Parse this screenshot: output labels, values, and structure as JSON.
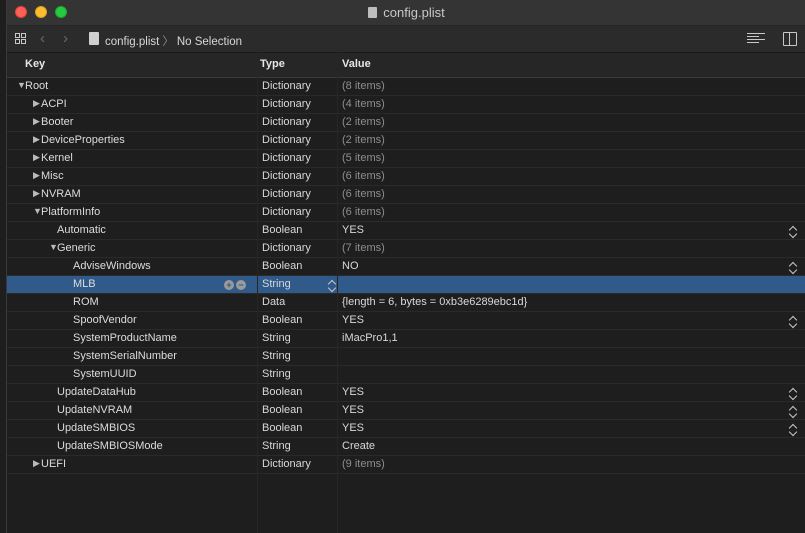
{
  "window": {
    "title": "config.plist"
  },
  "toolbar": {
    "file": "config.plist",
    "separator": "〉",
    "selection": "No Selection"
  },
  "columns": {
    "key": "Key",
    "type": "Type",
    "value": "Value"
  },
  "rows": [
    {
      "key": "Root",
      "type": "Dictionary",
      "value": "(8 items)",
      "muted": true,
      "indent": 0,
      "disclosure": "open"
    },
    {
      "key": "ACPI",
      "type": "Dictionary",
      "value": "(4 items)",
      "muted": true,
      "indent": 1,
      "disclosure": "closed"
    },
    {
      "key": "Booter",
      "type": "Dictionary",
      "value": "(2 items)",
      "muted": true,
      "indent": 1,
      "disclosure": "closed"
    },
    {
      "key": "DeviceProperties",
      "type": "Dictionary",
      "value": "(2 items)",
      "muted": true,
      "indent": 1,
      "disclosure": "closed"
    },
    {
      "key": "Kernel",
      "type": "Dictionary",
      "value": "(5 items)",
      "muted": true,
      "indent": 1,
      "disclosure": "closed"
    },
    {
      "key": "Misc",
      "type": "Dictionary",
      "value": "(6 items)",
      "muted": true,
      "indent": 1,
      "disclosure": "closed"
    },
    {
      "key": "NVRAM",
      "type": "Dictionary",
      "value": "(6 items)",
      "muted": true,
      "indent": 1,
      "disclosure": "closed"
    },
    {
      "key": "PlatformInfo",
      "type": "Dictionary",
      "value": "(6 items)",
      "muted": true,
      "indent": 1,
      "disclosure": "open"
    },
    {
      "key": "Automatic",
      "type": "Boolean",
      "value": "YES",
      "indent": 2,
      "stepper": true
    },
    {
      "key": "Generic",
      "type": "Dictionary",
      "value": "(7 items)",
      "muted": true,
      "indent": 2,
      "disclosure": "open"
    },
    {
      "key": "AdviseWindows",
      "type": "Boolean",
      "value": "NO",
      "indent": 3,
      "stepper": true
    },
    {
      "key": "MLB",
      "type": "String",
      "value": "",
      "indent": 3,
      "selected": true
    },
    {
      "key": "ROM",
      "type": "Data",
      "value": "{length = 6, bytes = 0xb3e6289ebc1d}",
      "indent": 3
    },
    {
      "key": "SpoofVendor",
      "type": "Boolean",
      "value": "YES",
      "indent": 3,
      "stepper": true
    },
    {
      "key": "SystemProductName",
      "type": "String",
      "value": "iMacPro1,1",
      "indent": 3
    },
    {
      "key": "SystemSerialNumber",
      "type": "String",
      "value": "",
      "indent": 3
    },
    {
      "key": "SystemUUID",
      "type": "String",
      "value": "",
      "indent": 3
    },
    {
      "key": "UpdateDataHub",
      "type": "Boolean",
      "value": "YES",
      "indent": 2,
      "stepper": true
    },
    {
      "key": "UpdateNVRAM",
      "type": "Boolean",
      "value": "YES",
      "indent": 2,
      "stepper": true
    },
    {
      "key": "UpdateSMBIOS",
      "type": "Boolean",
      "value": "YES",
      "indent": 2,
      "stepper": true
    },
    {
      "key": "UpdateSMBIOSMode",
      "type": "String",
      "value": "Create",
      "indent": 2
    },
    {
      "key": "UEFI",
      "type": "Dictionary",
      "value": "(9 items)",
      "muted": true,
      "indent": 1,
      "disclosure": "closed"
    }
  ],
  "colors": {
    "selection": "#2f5a89",
    "background": "#1e1e1e"
  }
}
